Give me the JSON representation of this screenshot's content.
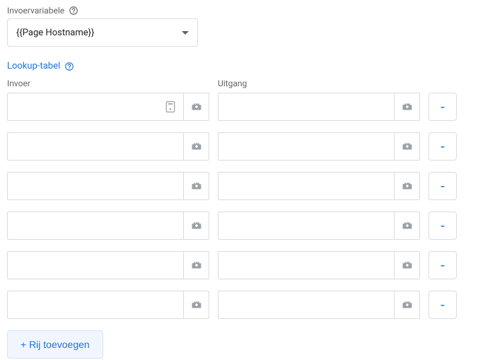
{
  "inputVar": {
    "label": "Invoervariabele",
    "value": "{{Page Hostname}}"
  },
  "lookupLink": "Lookup-tabel",
  "columns": {
    "input": "Invoer",
    "output": "Uitgang"
  },
  "rows": [
    {
      "input": "",
      "output": "",
      "hasMetaIcon": true
    },
    {
      "input": "",
      "output": "",
      "hasMetaIcon": false
    },
    {
      "input": "",
      "output": "",
      "hasMetaIcon": false
    },
    {
      "input": "",
      "output": "",
      "hasMetaIcon": false
    },
    {
      "input": "",
      "output": "",
      "hasMetaIcon": false
    },
    {
      "input": "",
      "output": "",
      "hasMetaIcon": false
    }
  ],
  "removeLabel": "-",
  "addRowLabel": "+ Rij toevoegen"
}
